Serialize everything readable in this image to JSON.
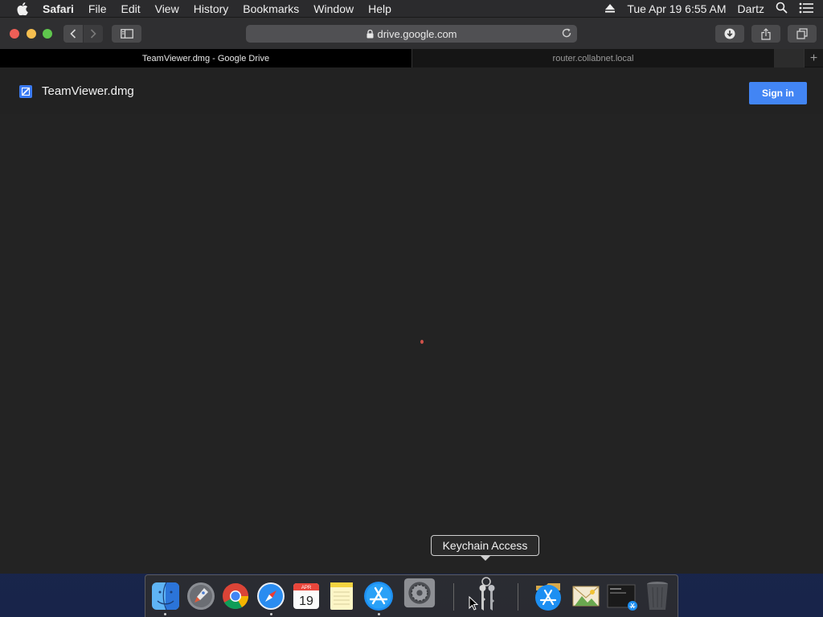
{
  "menubar": {
    "app_name": "Safari",
    "items": [
      "File",
      "Edit",
      "View",
      "History",
      "Bookmarks",
      "Window",
      "Help"
    ],
    "datetime": "Tue Apr 19  6:55 AM",
    "user": "Dartz"
  },
  "toolbar": {
    "address": "drive.google.com"
  },
  "tabs": [
    {
      "label": "TeamViewer.dmg - Google Drive",
      "active": true
    },
    {
      "label": "router.collabnet.local",
      "active": false
    }
  ],
  "tabs_new_label": "+",
  "drive": {
    "file_name": "TeamViewer.dmg",
    "sign_in_label": "Sign in"
  },
  "tooltip": {
    "text": "Keychain Access"
  },
  "dock": {
    "calendar_month": "APR",
    "calendar_day": "19",
    "items": [
      "finder-icon",
      "launchpad-icon",
      "chrome-icon",
      "safari-icon",
      "calendar-icon",
      "notes-icon",
      "app-store-icon",
      "system-preferences-icon",
      "keychain-access-icon",
      "app-store-folder-icon",
      "mail-photos-icon",
      "stack-icon",
      "trash-icon"
    ]
  },
  "colors": {
    "accent": "#4285f4",
    "close": "#ed5f57",
    "minimize": "#f5be4f",
    "zoom": "#5fc64d"
  }
}
